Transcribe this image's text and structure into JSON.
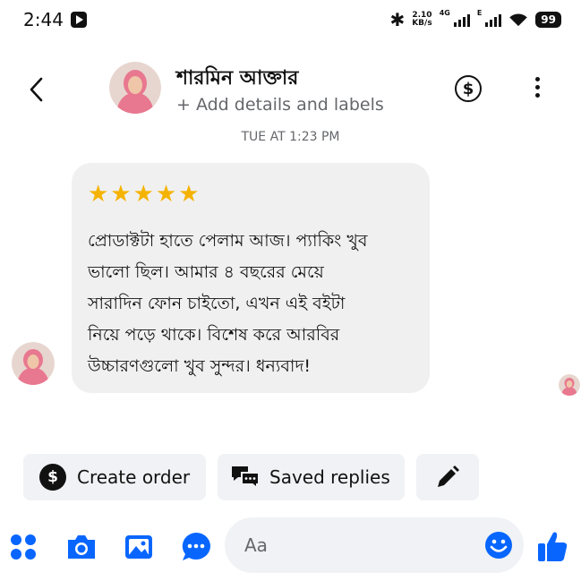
{
  "status_bar": {
    "time": "2:44",
    "speed_value": "2.10",
    "speed_unit": "KB/s",
    "net_label": "4G",
    "net_label_2": "E",
    "battery": "99",
    "bluetooth_icon": "bluetooth-icon",
    "wifi_icon": "wifi-icon"
  },
  "header": {
    "contact_name": "শারমিন আক্তার",
    "add_details": "+ Add details and labels",
    "back_icon": "chevron-left-icon",
    "payment_icon": "dollar-circle-icon",
    "more_icon": "more-vertical-icon"
  },
  "conversation": {
    "timestamp": "TUE AT 1:23 PM",
    "message": {
      "stars": "★★★★★",
      "lines": [
        "প্রোডাক্টটা হাতে পেলাম আজ। প্যাকিং খুব",
        "ভালো ছিল। আমার ৪ বছরের মেয়ে",
        "সারাদিন ফোন চাইতো, এখন এই বইটা",
        "নিয়ে পড়ে থাকে। বিশেষ করে আরবির",
        "উচ্চারণগুলো খুব সুন্দর। ধন্যবাদ!"
      ]
    }
  },
  "quick_actions": {
    "create_order": "Create order",
    "saved_replies": "Saved replies",
    "edit_icon": "pencil-icon"
  },
  "composer": {
    "placeholder": "Aa",
    "icons": [
      "apps-icon",
      "camera-icon",
      "image-icon",
      "chat-bubble-icon",
      "emoji-icon",
      "thumbs-up-icon"
    ]
  },
  "colors": {
    "accent": "#0866ff",
    "bubble": "#f0f0f0",
    "secondary_text": "#65676b",
    "chip_bg": "#f0f2f5",
    "star": "#f5b301"
  }
}
